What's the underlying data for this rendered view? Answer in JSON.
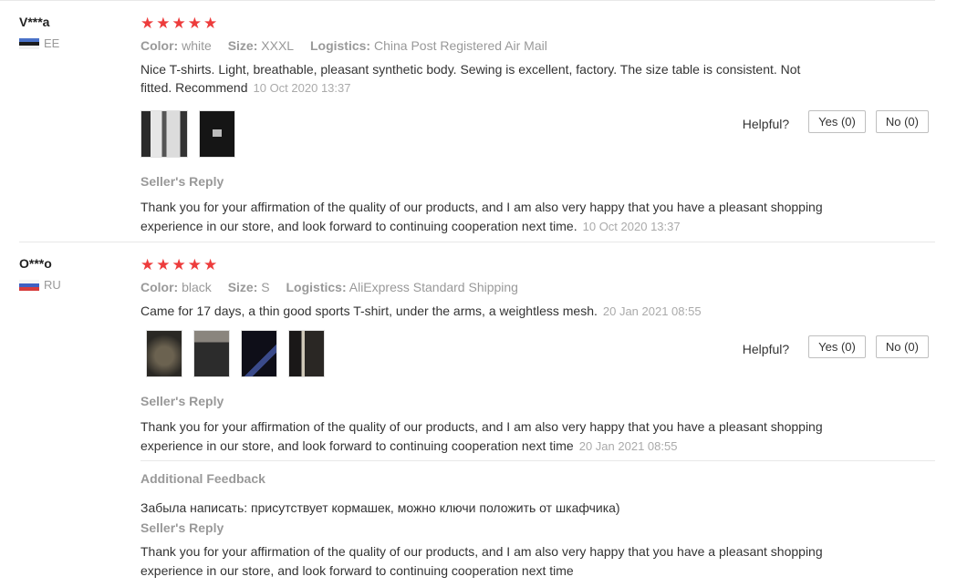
{
  "reviews": [
    {
      "user": "V***a",
      "country": "EE",
      "stars": "★★★★★",
      "color_label": "Color:",
      "color": "white",
      "size_label": "Size:",
      "size": "XXXL",
      "logistics_label": "Logistics:",
      "logistics": "China Post Registered Air Mail",
      "text": "Nice T-shirts. Light, breathable, pleasant synthetic body. Sewing is excellent, factory. The size table is consistent. Not fitted. Recommend",
      "date": "10 Oct 2020 13:37",
      "helpful_label": "Helpful?",
      "yes": "Yes (0)",
      "no": "No (0)",
      "seller_reply_title": "Seller's Reply",
      "seller_reply": "Thank you for your affirmation of the quality of our products, and I am also very happy that you have a pleasant shopping experience in our store, and look forward to continuing cooperation next time.",
      "seller_reply_date": "10 Oct 2020 13:37"
    },
    {
      "user": "O***o",
      "country": "RU",
      "stars": "★★★★★",
      "color_label": "Color:",
      "color": "black",
      "size_label": "Size:",
      "size": "S",
      "logistics_label": "Logistics:",
      "logistics": "AliExpress Standard Shipping",
      "text": "Came for 17 days, a thin good sports T-shirt, under the arms, a weightless mesh.",
      "date": "20 Jan 2021 08:55",
      "helpful_label": "Helpful?",
      "yes": "Yes (0)",
      "no": "No (0)",
      "seller_reply_title": "Seller's Reply",
      "seller_reply": "Thank you for your affirmation of the quality of our products, and I am also very happy that you have a pleasant shopping experience in our store, and look forward to continuing cooperation next time",
      "seller_reply_date": "20 Jan 2021 08:55",
      "additional_title": "Additional Feedback",
      "additional_text": "Забыла написать: присутствует кормашек, можно ключи положить от шкафчика)",
      "additional_reply_title": "Seller's Reply",
      "additional_reply": "Thank you for your affirmation of the quality of our products, and I am also very happy that you have a pleasant shopping experience in our store, and look forward to continuing cooperation next time"
    }
  ],
  "colors": {
    "star": "#ed3c3c",
    "muted": "#999999",
    "divider": "#e8e8e8"
  }
}
